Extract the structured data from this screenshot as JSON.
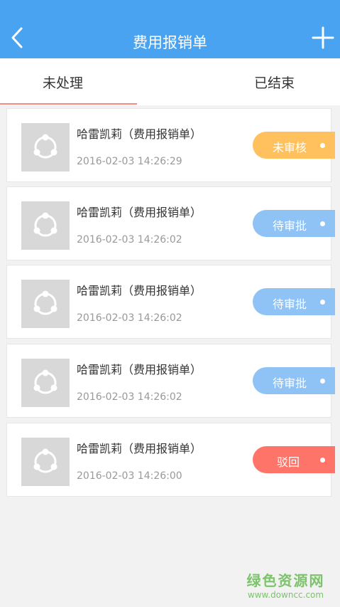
{
  "header": {
    "title": "费用报销单"
  },
  "tabs": [
    {
      "label": "未处理",
      "active": true
    },
    {
      "label": "已结束",
      "active": false
    }
  ],
  "colors": {
    "header": "#4aa3f0",
    "tab_underline": "#f28b83",
    "status_pending_review": "#ffc15e",
    "status_pending_approval": "#8fc2f5",
    "status_rejected": "#ff7468"
  },
  "items": [
    {
      "name": "哈雷凯莉（费用报销单）",
      "time": "2016-02-03 14:26:29",
      "status": "未审核",
      "status_color": "#ffc15e"
    },
    {
      "name": "哈雷凯莉（费用报销单）",
      "time": "2016-02-03 14:26:02",
      "status": "待审批",
      "status_color": "#8fc2f5"
    },
    {
      "name": "哈雷凯莉（费用报销单）",
      "time": "2016-02-03 14:26:02",
      "status": "待审批",
      "status_color": "#8fc2f5"
    },
    {
      "name": "哈雷凯莉（费用报销单）",
      "time": "2016-02-03 14:26:02",
      "status": "待审批",
      "status_color": "#8fc2f5"
    },
    {
      "name": "哈雷凯莉（费用报销单）",
      "time": "2016-02-03 14:26:00",
      "status": "驳回",
      "status_color": "#ff7468"
    }
  ],
  "watermark": {
    "main": "绿色资源网",
    "sub": "www.downcc.com"
  }
}
